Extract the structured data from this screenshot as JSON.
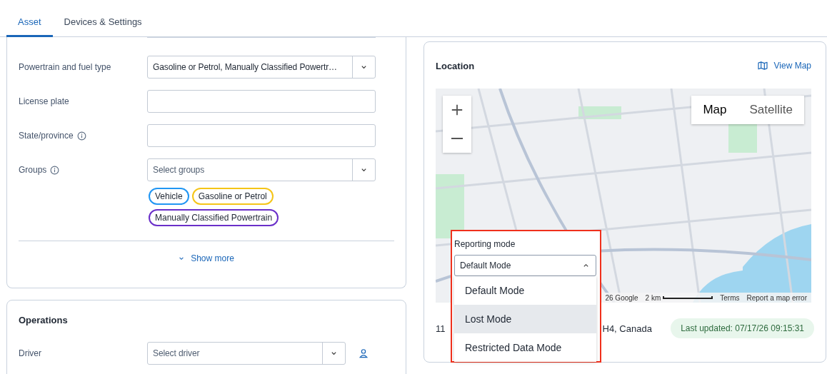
{
  "tabs": [
    {
      "label": "Asset",
      "selected": true
    },
    {
      "label": "Devices & Settings",
      "selected": false
    }
  ],
  "asset_form": {
    "fields": [
      {
        "label": "Powertrain and fuel type",
        "kind": "select",
        "value": "Gasoline or Petrol, Manually Classified Powertr…",
        "info": false
      },
      {
        "label": "License plate",
        "kind": "text",
        "info": false
      },
      {
        "label": "State/province",
        "kind": "text",
        "info": true
      },
      {
        "label": "Groups",
        "kind": "select",
        "placeholder": "Select groups",
        "info": true
      }
    ],
    "group_tags": [
      {
        "label": "Vehicle",
        "color": "#2196f3"
      },
      {
        "label": "Gasoline or Petrol",
        "color": "#f5c518"
      },
      {
        "label": "Manually Classified Powertrain",
        "color": "#6a2fc9"
      }
    ],
    "show_more": "Show more"
  },
  "operations": {
    "title": "Operations",
    "fields": [
      {
        "label": "Driver",
        "placeholder": "Select driver"
      }
    ]
  },
  "location": {
    "title": "Location",
    "view_map": "View Map",
    "map": {
      "kind": "picture",
      "map_types": [
        {
          "label": "Map",
          "selected": true
        },
        {
          "label": "Satellite",
          "selected": false
        }
      ],
      "attribution": "26 Google",
      "scale": "2 km",
      "terms": "Terms",
      "report": "Report a map error"
    },
    "address_start": "11",
    "address_end": "H4, Canada",
    "last_updated": "Last updated: 07/17/26 09:15:31",
    "reporting_mode": {
      "label": "Reporting mode",
      "value": "Default Mode",
      "expanded": true,
      "options": [
        {
          "label": "Default Mode",
          "highlighted": false
        },
        {
          "label": "Lost Mode",
          "highlighted": true
        },
        {
          "label": "Restricted Data Mode",
          "highlighted": false
        }
      ]
    }
  }
}
